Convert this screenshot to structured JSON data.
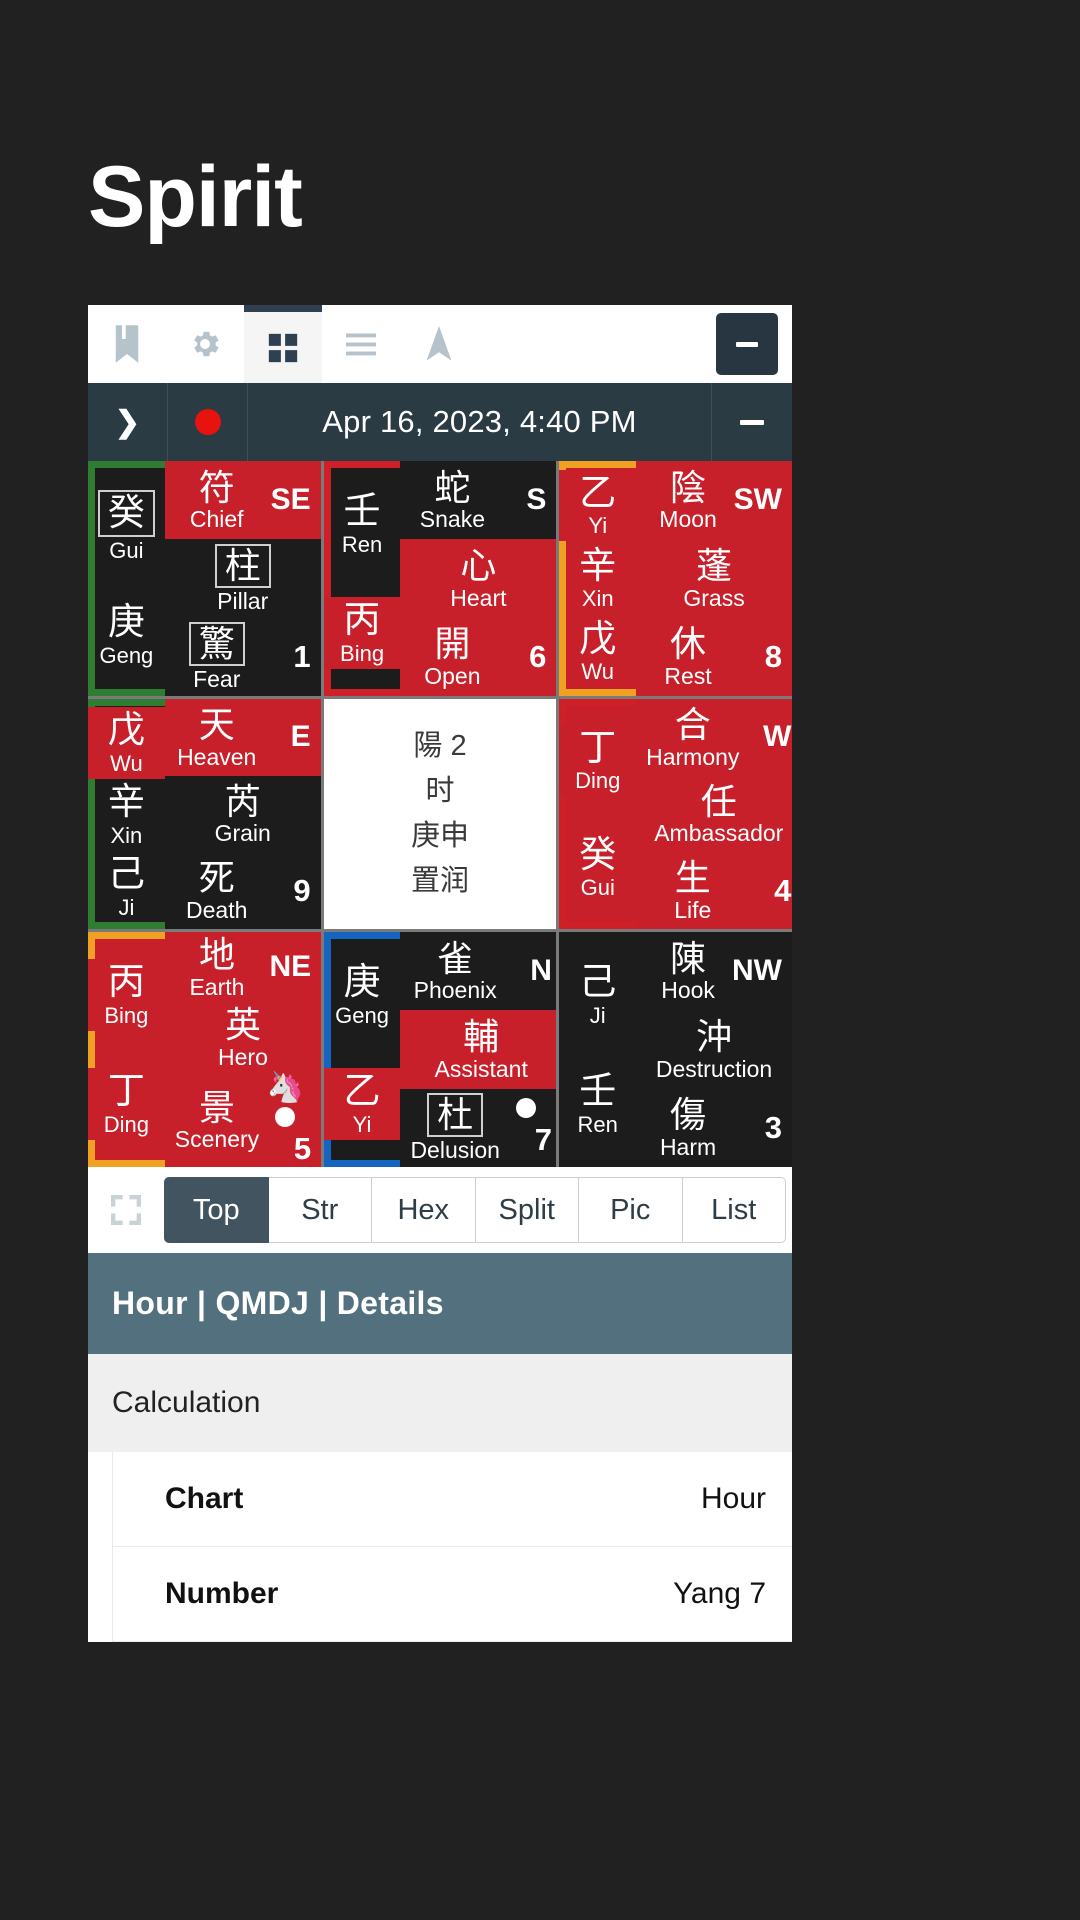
{
  "app": {
    "title": "Spirit"
  },
  "toolbar": {
    "icons": [
      {
        "name": "book-icon",
        "label": "Book"
      },
      {
        "name": "gear-icon",
        "label": "Settings"
      },
      {
        "name": "grid-icon",
        "label": "Grid",
        "active": true
      },
      {
        "name": "list-icon",
        "label": "List"
      },
      {
        "name": "navigate-icon",
        "label": "Navigate"
      }
    ],
    "minimize_label": "−"
  },
  "datebar": {
    "chevron": "❯",
    "dot_color": "#e8120e",
    "date": "Apr 16, 2023, 4:40 PM",
    "minus_label": "−"
  },
  "chart": {
    "palaces": [
      {
        "id": "SE",
        "direction": "SE",
        "border": "green",
        "panel_bg": "dark",
        "stems": [
          {
            "cn": "癸",
            "en": "Gui",
            "boxed": true,
            "bg": "dark"
          },
          {
            "cn": "庚",
            "en": "Geng",
            "boxed": false,
            "bg": "dark"
          }
        ],
        "rows": [
          {
            "cn": "符",
            "en": "Chief",
            "bg": "red",
            "corner": "SE",
            "corner_type": "dir"
          },
          {
            "cn": "柱",
            "en": "Pillar",
            "bg": "dark",
            "boxed": true,
            "corner": "",
            "corner_type": "none"
          },
          {
            "cn": "驚",
            "en": "Fear",
            "bg": "dark",
            "boxed": true,
            "corner": "1",
            "corner_type": "num"
          }
        ]
      },
      {
        "id": "S",
        "direction": "S",
        "border": "red",
        "panel_bg": "dark",
        "stems": [
          {
            "cn": "壬",
            "en": "Ren",
            "boxed": false,
            "bg": "dark"
          },
          {
            "cn": "丙",
            "en": "Bing",
            "boxed": false,
            "bg": "red"
          }
        ],
        "rows": [
          {
            "cn": "蛇",
            "en": "Snake",
            "bg": "dark",
            "corner": "S",
            "corner_type": "dir"
          },
          {
            "cn": "心",
            "en": "Heart",
            "bg": "red",
            "corner": "",
            "corner_type": "none"
          },
          {
            "cn": "開",
            "en": "Open",
            "bg": "red",
            "corner": "6",
            "corner_type": "num"
          }
        ]
      },
      {
        "id": "SW",
        "direction": "SW",
        "border": "orange",
        "panel_bg": "red",
        "stems": [
          {
            "cn": "乙",
            "en": "Yi",
            "boxed": false,
            "bg": "red"
          },
          {
            "cn": "辛",
            "en": "Xin",
            "boxed": false,
            "bg": "dark"
          },
          {
            "cn": "戊",
            "en": "Wu",
            "boxed": false,
            "bg": "dark"
          }
        ],
        "rows": [
          {
            "cn": "陰",
            "en": "Moon",
            "bg": "red",
            "corner": "SW",
            "corner_type": "dir"
          },
          {
            "cn": "蓬",
            "en": "Grass",
            "bg": "red",
            "corner": "",
            "corner_type": "none"
          },
          {
            "cn": "休",
            "en": "Rest",
            "bg": "red",
            "corner": "8",
            "corner_type": "num"
          }
        ]
      },
      {
        "id": "E",
        "direction": "E",
        "border": "green",
        "panel_bg": "dark",
        "stems": [
          {
            "cn": "戊",
            "en": "Wu",
            "boxed": false,
            "bg": "red"
          },
          {
            "cn": "辛",
            "en": "Xin",
            "boxed": false,
            "bg": "dark"
          },
          {
            "cn": "己",
            "en": "Ji",
            "boxed": false,
            "bg": "dark"
          }
        ],
        "rows": [
          {
            "cn": "天",
            "en": "Heaven",
            "bg": "red",
            "corner": "E",
            "corner_type": "dir"
          },
          {
            "cn": "芮",
            "en": "Grain",
            "bg": "dark",
            "corner": "",
            "corner_type": "none"
          },
          {
            "cn": "死",
            "en": "Death",
            "bg": "dark",
            "corner": "9",
            "corner_type": "num"
          }
        ]
      },
      {
        "id": "CENTER",
        "direction": "",
        "border": "none",
        "panel_bg": "white",
        "center_lines": [
          "陽 2",
          "时",
          "庚申",
          "置润"
        ]
      },
      {
        "id": "W",
        "direction": "W",
        "border": "red",
        "panel_bg": "red",
        "stems": [
          {
            "cn": "丁",
            "en": "Ding",
            "boxed": false,
            "bg": "red"
          },
          {
            "cn": "癸",
            "en": "Gui",
            "boxed": false,
            "bg": "dark"
          }
        ],
        "rows": [
          {
            "cn": "合",
            "en": "Harmony",
            "bg": "red",
            "corner": "W",
            "corner_type": "dir"
          },
          {
            "cn": "任",
            "en": "Ambassador",
            "bg": "red",
            "corner": "",
            "corner_type": "none"
          },
          {
            "cn": "生",
            "en": "Life",
            "bg": "red",
            "corner": "4",
            "corner_type": "num"
          }
        ]
      },
      {
        "id": "NE",
        "direction": "NE",
        "border": "orange",
        "panel_bg": "red",
        "stems": [
          {
            "cn": "丙",
            "en": "Bing",
            "boxed": false,
            "bg": "red"
          },
          {
            "cn": "丁",
            "en": "Ding",
            "boxed": false,
            "bg": "red"
          }
        ],
        "rows": [
          {
            "cn": "地",
            "en": "Earth",
            "bg": "red",
            "corner": "NE",
            "corner_type": "dir"
          },
          {
            "cn": "英",
            "en": "Hero",
            "bg": "red",
            "corner": "",
            "corner_type": "none"
          },
          {
            "cn": "景",
            "en": "Scenery",
            "bg": "red",
            "corner": "5",
            "corner_type": "num",
            "unicorn": true,
            "dot": true
          }
        ]
      },
      {
        "id": "N",
        "direction": "N",
        "border": "blue",
        "panel_bg": "dark",
        "stems": [
          {
            "cn": "庚",
            "en": "Geng",
            "boxed": false,
            "bg": "dark"
          },
          {
            "cn": "乙",
            "en": "Yi",
            "boxed": false,
            "bg": "red"
          }
        ],
        "rows": [
          {
            "cn": "雀",
            "en": "Phoenix",
            "bg": "dark",
            "corner": "N",
            "corner_type": "dir"
          },
          {
            "cn": "輔",
            "en": "Assistant",
            "bg": "red",
            "corner": "",
            "corner_type": "none"
          },
          {
            "cn": "杜",
            "en": "Delusion",
            "bg": "dark",
            "boxed": true,
            "corner": "7",
            "corner_type": "num",
            "dot": true
          }
        ]
      },
      {
        "id": "NW",
        "direction": "NW",
        "border": "none",
        "panel_bg": "dark",
        "stems": [
          {
            "cn": "己",
            "en": "Ji",
            "boxed": false,
            "bg": "dark"
          },
          {
            "cn": "壬",
            "en": "Ren",
            "boxed": false,
            "bg": "dark"
          }
        ],
        "rows": [
          {
            "cn": "陳",
            "en": "Hook",
            "bg": "dark",
            "corner": "NW",
            "corner_type": "dir"
          },
          {
            "cn": "沖",
            "en": "Destruction",
            "bg": "dark",
            "corner": "",
            "corner_type": "none"
          },
          {
            "cn": "傷",
            "en": "Harm",
            "bg": "dark",
            "corner": "3",
            "corner_type": "num"
          }
        ]
      }
    ]
  },
  "tabstrip": {
    "expand_icon": "expand-icon",
    "tabs": [
      {
        "label": "Top",
        "active": true
      },
      {
        "label": "Str",
        "active": false
      },
      {
        "label": "Hex",
        "active": false
      },
      {
        "label": "Split",
        "active": false
      },
      {
        "label": "Pic",
        "active": false
      },
      {
        "label": "List",
        "active": false
      }
    ]
  },
  "details": {
    "header": "Hour | QMDJ | Details",
    "section": "Calculation",
    "rows": [
      {
        "key": "Chart",
        "value": "Hour"
      },
      {
        "key": "Number",
        "value": "Yang 7"
      }
    ]
  }
}
